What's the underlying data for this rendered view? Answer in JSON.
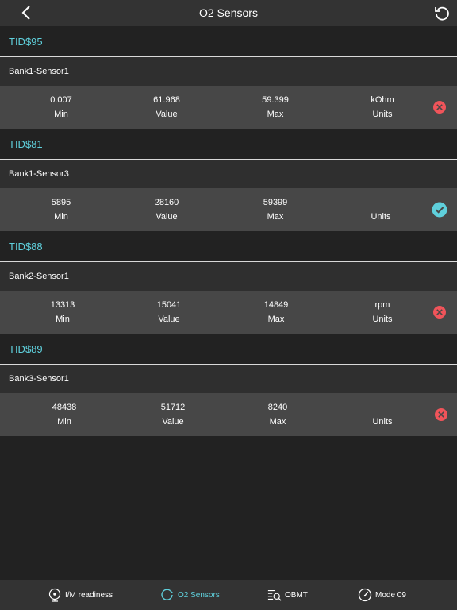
{
  "navbar": {
    "title": "O2 Sensors",
    "back_icon": "chevron-left-icon",
    "refresh_icon": "refresh-icon"
  },
  "colors": {
    "accent": "#5fd0dc",
    "fail": "#f0545a",
    "pass": "#5fd0dc"
  },
  "sections": [
    {
      "tid": "TID$95",
      "sensor": "Bank1-Sensor1",
      "min": "0.007",
      "min_label": "Min",
      "value": "61.968",
      "value_label": "Value",
      "max": "59.399",
      "max_label": "Max",
      "unit": "kOhm",
      "unit_label": "Units",
      "status": "fail"
    },
    {
      "tid": "TID$81",
      "sensor": "Bank1-Sensor3",
      "min": "5895",
      "min_label": "Min",
      "value": "28160",
      "value_label": "Value",
      "max": "59399",
      "max_label": "Max",
      "unit": "",
      "unit_label": "Units",
      "status": "pass"
    },
    {
      "tid": "TID$88",
      "sensor": "Bank2-Sensor1",
      "min": "13313",
      "min_label": "Min",
      "value": "15041",
      "value_label": "Value",
      "max": "14849",
      "max_label": "Max",
      "unit": "rpm",
      "unit_label": "Units",
      "status": "fail"
    },
    {
      "tid": "TID$89",
      "sensor": "Bank3-Sensor1",
      "min": "48438",
      "min_label": "Min",
      "value": "51712",
      "value_label": "Value",
      "max": "8240",
      "max_label": "Max",
      "unit": "",
      "unit_label": "Units",
      "status": "fail"
    }
  ],
  "tabs": [
    {
      "label": "I/M readiness",
      "icon": "readiness-icon",
      "active": false
    },
    {
      "label": "O2 Sensors",
      "icon": "o2-sensor-icon",
      "active": true
    },
    {
      "label": "OBMT",
      "icon": "obmt-icon",
      "active": false
    },
    {
      "label": "Mode 09",
      "icon": "gauge-icon",
      "active": false
    }
  ]
}
